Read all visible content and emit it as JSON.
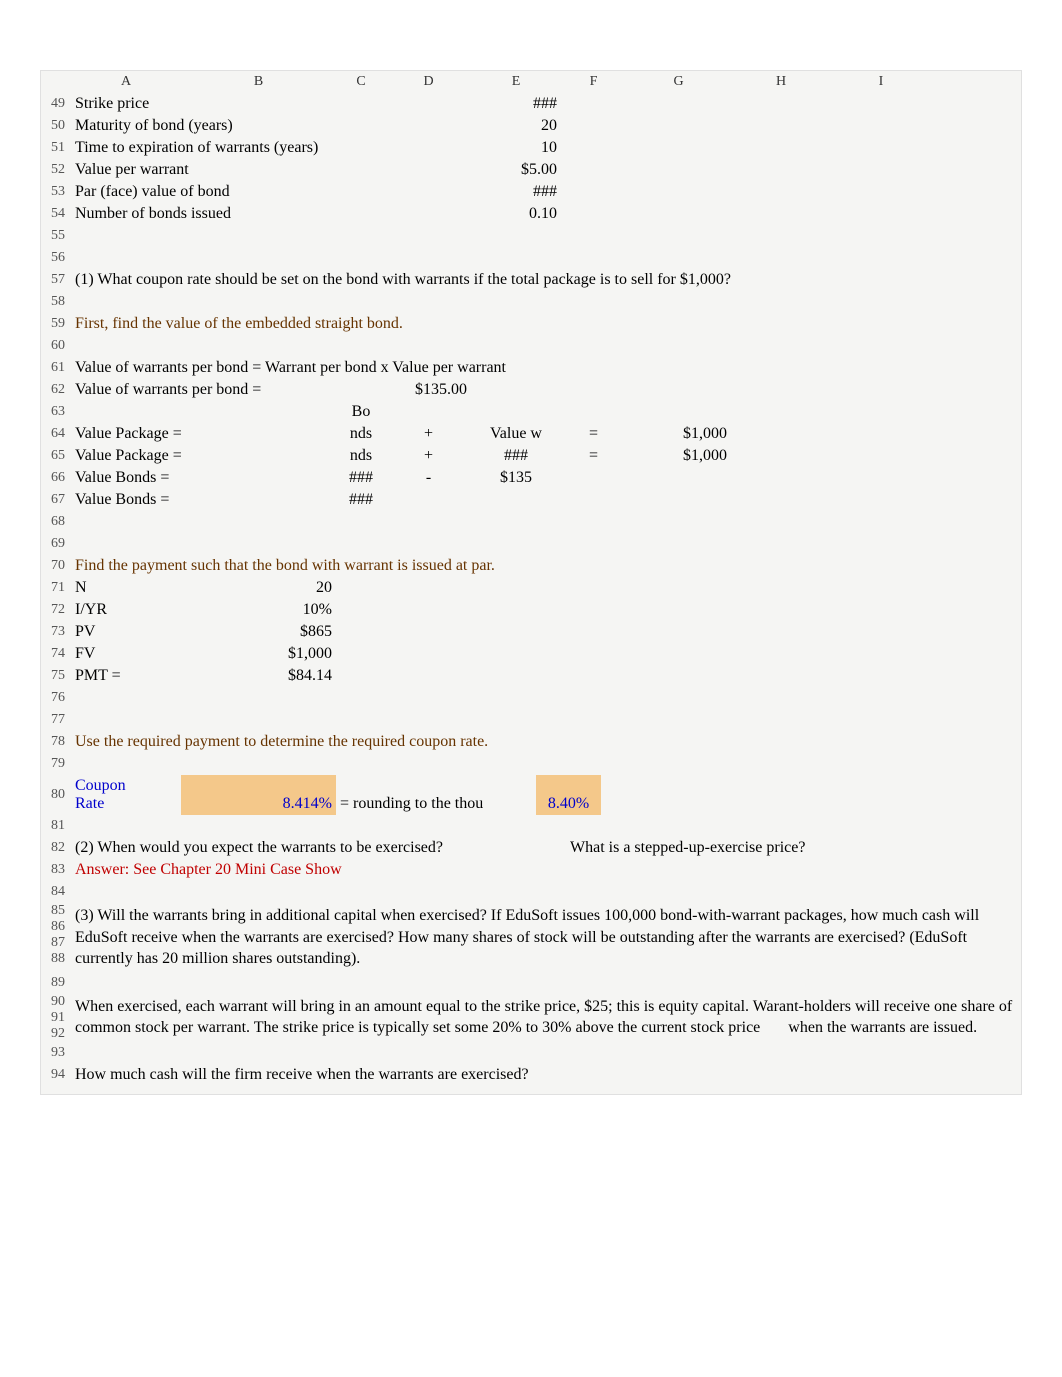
{
  "columns": {
    "row": "",
    "a": "A",
    "b": "B",
    "c": "C",
    "d": "D",
    "e": "E",
    "f": "F",
    "g": "G",
    "h": "H",
    "i": "I"
  },
  "r49": {
    "label": "Strike price",
    "e": "###"
  },
  "r50": {
    "label": "Maturity of bond (years)",
    "e": "20"
  },
  "r51": {
    "label": "Time to expiration of warrants (years)",
    "e": "10"
  },
  "r52": {
    "label": "Value per warrant",
    "e": "$5.00"
  },
  "r53": {
    "label": "Par (face) value of bond",
    "e": "###"
  },
  "r54": {
    "label": "Number of bonds issued",
    "e": "0.10"
  },
  "r57": {
    "text": "(1) What coupon rate should be set on the bond with warrants if the total package is to sell for $1,000?"
  },
  "r59": {
    "text": "First, find the value of the embedded straight bond."
  },
  "r61": {
    "text": "Value of warrants per bond = Warrant per bond x Value per warrant"
  },
  "r62": {
    "label": "Value of warrants per bond =",
    "d": "$135.00"
  },
  "r63": {
    "c": "Bo"
  },
  "r64": {
    "a": "Value Package  =",
    "c": "nds",
    "d": "+",
    "e": "Value w",
    "f": "=",
    "g": "$1,000"
  },
  "r65": {
    "a": "Value Package  =",
    "c": "nds",
    "d": "+",
    "e": "###",
    "f": "=",
    "g": "$1,000"
  },
  "r66": {
    "a": "Value Bonds =",
    "c": "###",
    "d": "-",
    "e": "$135"
  },
  "r67": {
    "a": "Value Bonds =",
    "c": "###"
  },
  "r70": {
    "text": "Find the payment such that the bond with warrant is issued at par."
  },
  "r71": {
    "a": "N",
    "b": "20"
  },
  "r72": {
    "a": "I/YR",
    "b": "10%"
  },
  "r73": {
    "a": "PV",
    "b": "$865"
  },
  "r74": {
    "a": "FV",
    "b": "$1,000"
  },
  "r75": {
    "a": "PMT =",
    "b": "$84.14"
  },
  "r78": {
    "text": "Use the required payment to determine the required coupon rate."
  },
  "r80": {
    "a1": "Coupon",
    "a2": "Rate",
    "b": "8.414%",
    "mid": "= rounding to the thou",
    "f": "8.40%"
  },
  "r82": {
    "left": "(2) When would you expect the warrants to be exercised?",
    "right": "What is a stepped-up-exercise price?"
  },
  "r83": {
    "text": "Answer: See Chapter 20 Mini Case Show"
  },
  "r85_88": {
    "text": "(3) Will the warrants bring in additional capital when exercised? If EduSoft issues 100,000 bond-with-warrant packages, how much cash will EduSoft receive when the warrants are exercised? How many shares of stock will be outstanding after the warrants are exercised? (EduSoft currently has 20 million shares outstanding)."
  },
  "r90_92": {
    "text1": "When exercised, each warrant will bring in an amount equal to the strike price, $25; this is equity capital. Warant-holders will receive one share of common stock per warrant. The strike price is typically set some 20% to 30% above the current stock price",
    "text2": "when the warrants are issued."
  },
  "r94": {
    "text": "How much cash will the firm receive when the warrants are exercised?"
  }
}
